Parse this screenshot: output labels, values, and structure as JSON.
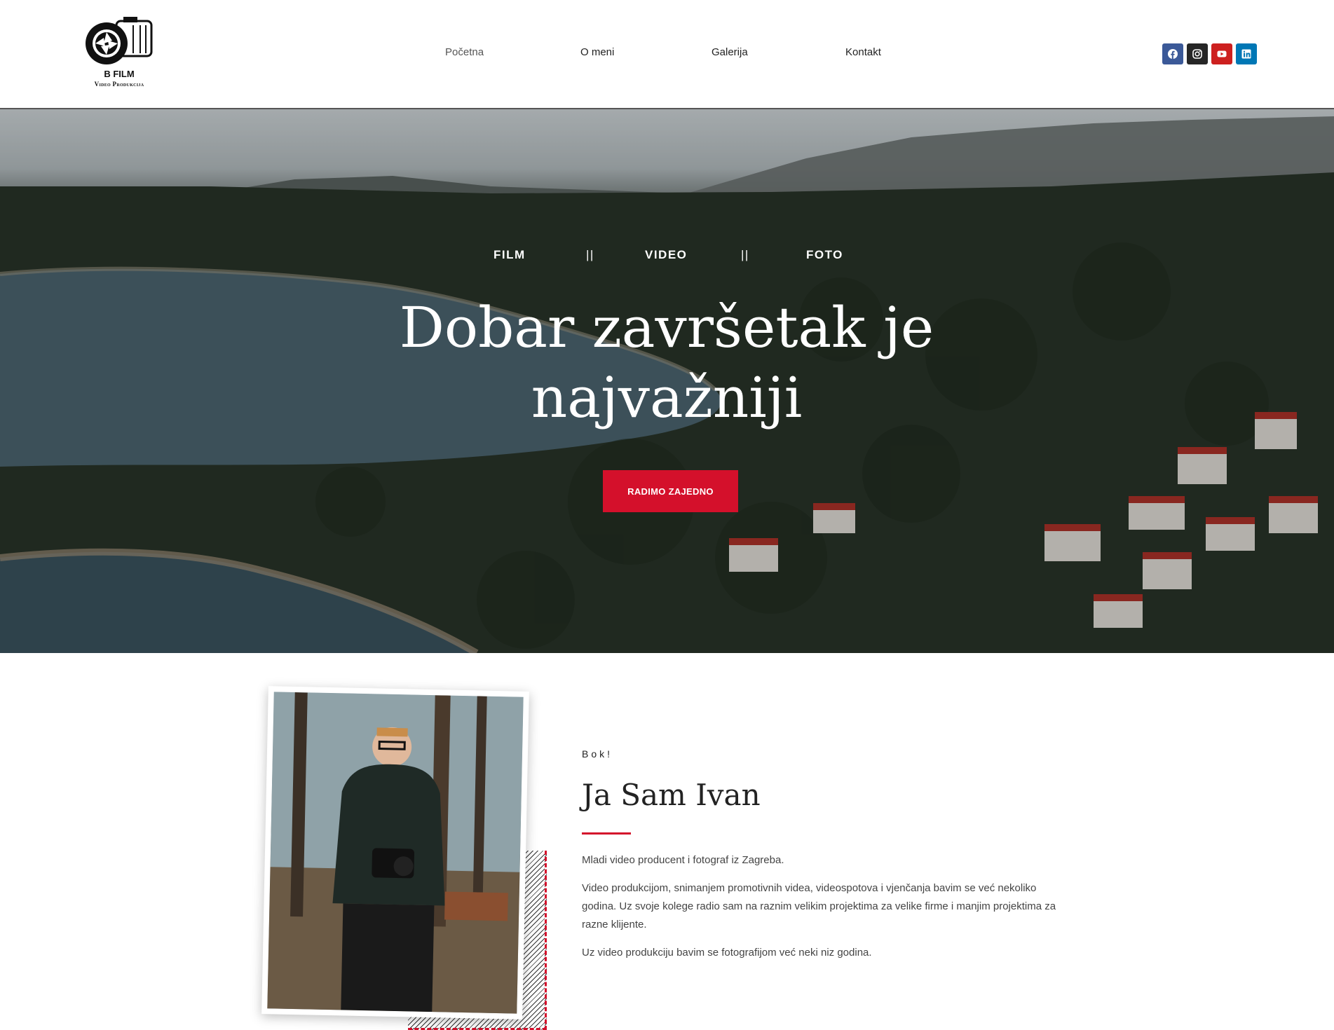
{
  "header": {
    "logo": {
      "brand": "B FILM",
      "sub": "Video Produkcija"
    },
    "nav": [
      {
        "label": "Početna",
        "active": true
      },
      {
        "label": "O meni"
      },
      {
        "label": "Galerija"
      },
      {
        "label": "Kontakt"
      }
    ],
    "social": [
      {
        "icon": "facebook-icon",
        "color": "#3b5998"
      },
      {
        "icon": "instagram-icon",
        "color": "#262626"
      },
      {
        "icon": "youtube-icon",
        "color": "#cd201f"
      },
      {
        "icon": "linkedin-icon",
        "color": "#0077b5"
      }
    ]
  },
  "hero": {
    "tags": [
      "FILM",
      "VIDEO",
      "FOTO"
    ],
    "separator": "||",
    "title_line1": "Dobar završetak je",
    "title_line2": "najvažniji",
    "cta": "RADIMO ZAJEDNO"
  },
  "about": {
    "greeting": "Bok!",
    "name": "Ja Sam Ivan",
    "paragraphs": [
      "Mladi video producent i fotograf iz Zagreba.",
      "Video produkcijom, snimanjem promotivnih videa, videospotova i vjenčanja bavim se već nekoliko godina. Uz svoje kolege radio sam na raznim velikim projektima za velike firme i manjim projektima za razne klijente.",
      "Uz video produkciju bavim se fotografijom već neki niz godina."
    ]
  },
  "colors": {
    "accent": "#d4102b"
  }
}
